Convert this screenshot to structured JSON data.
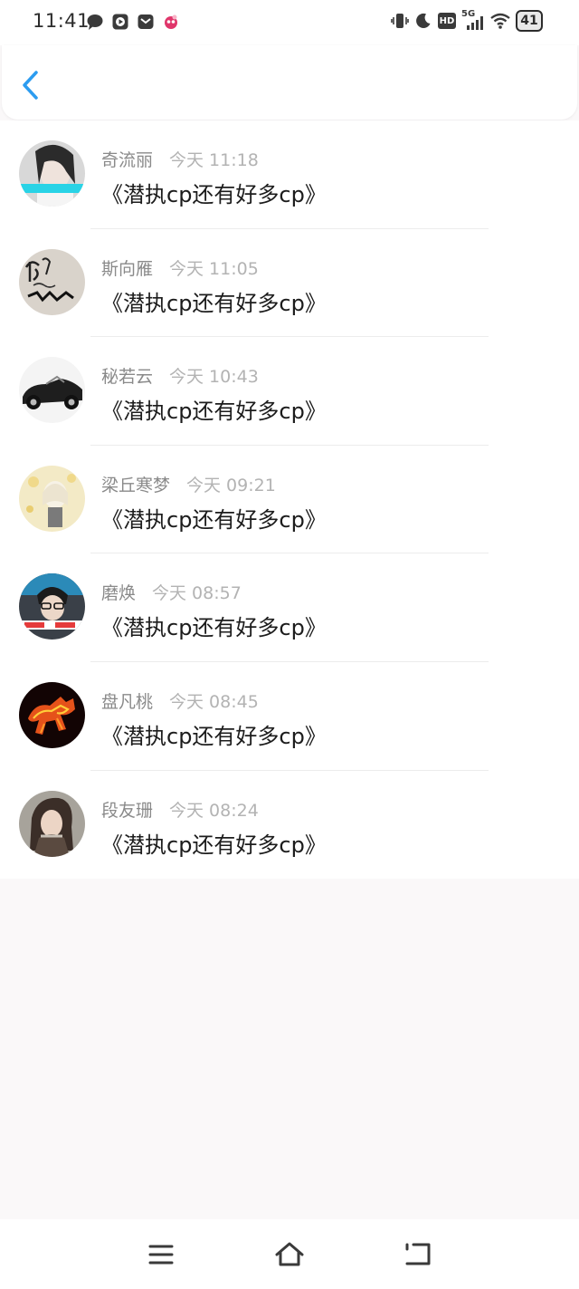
{
  "status_bar": {
    "time": "11:41",
    "network": "5G",
    "hd": "HD",
    "battery": "41"
  },
  "header": {
    "back_icon": "chevron-left-icon"
  },
  "colors": {
    "accent": "#2c9cf0",
    "name_text": "#8a8a8a",
    "time_text": "#b3b3b3",
    "message_text": "#1c1c1c"
  },
  "messages": [
    {
      "name": "奇流丽",
      "time": "今天 11:18",
      "text": "《潜执cp还有好多cp》"
    },
    {
      "name": "斯向雁",
      "time": "今天 11:05",
      "text": "《潜执cp还有好多cp》"
    },
    {
      "name": "秘若云",
      "time": "今天 10:43",
      "text": "《潜执cp还有好多cp》"
    },
    {
      "name": "梁丘寒梦",
      "time": "今天 09:21",
      "text": "《潜执cp还有好多cp》"
    },
    {
      "name": "磨焕",
      "time": "今天 08:57",
      "text": "《潜执cp还有好多cp》"
    },
    {
      "name": "盘凡桃",
      "time": "今天 08:45",
      "text": "《潜执cp还有好多cp》"
    },
    {
      "name": "段友珊",
      "time": "今天 08:24",
      "text": "《潜执cp还有好多cp》"
    }
  ],
  "nav_bar": {
    "menu_icon": "menu-icon",
    "home_icon": "home-icon",
    "back_icon": "back-icon"
  }
}
